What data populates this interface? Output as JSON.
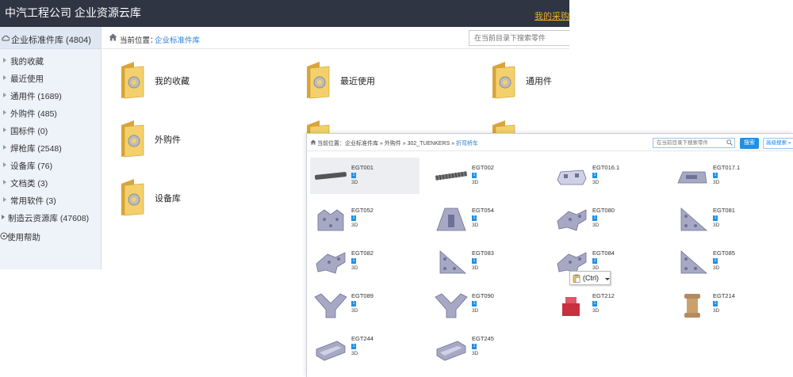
{
  "window": {
    "title": "中汽工程公司 企业资源云库",
    "user_link": "我的采购"
  },
  "sidebar": {
    "top_item": "企业标准件库 (4804)",
    "sub_items": [
      {
        "label": "我的收藏"
      },
      {
        "label": "最近使用"
      },
      {
        "label": "通用件 (1689)"
      },
      {
        "label": "外购件 (485)"
      },
      {
        "label": "国标件 (0)"
      },
      {
        "label": "焊枪库 (2548)"
      },
      {
        "label": "设备库 (76)"
      },
      {
        "label": "文档类 (3)"
      },
      {
        "label": "常用软件 (3)"
      }
    ],
    "root_item": "制造云资源库 (47608)",
    "help_item": "使用帮助"
  },
  "breadcrumb": {
    "label": "当前位置：",
    "link": "企业标准件库"
  },
  "search": {
    "placeholder": "在当前目录下搜索零件"
  },
  "folders": [
    {
      "label": "我的收藏"
    },
    {
      "label": "最近使用"
    },
    {
      "label": "通用件"
    },
    {
      "label": "外购件"
    },
    {
      "label": ""
    },
    {
      "label": ""
    },
    {
      "label": "设备库"
    }
  ],
  "overlay": {
    "breadcrumb": {
      "label": "当前位置：",
      "path": "企业标准件库 » 外购件 » 302_TUENKERS »",
      "current": "折弯桥车"
    },
    "search_placeholder": "在当前目录下搜索零件",
    "search_button": "搜索",
    "advanced_button": "高级搜索 »",
    "accent_color": "#1e90e6",
    "parts": [
      {
        "code": "EGT001",
        "badge": "1",
        "type": "3D",
        "icon": "rod-icon"
      },
      {
        "code": "EGT002",
        "badge": "1",
        "type": "3D",
        "icon": "threaded-rod-icon"
      },
      {
        "code": "EGT016.1",
        "badge": "1",
        "type": "3D",
        "icon": "bracket-icon"
      },
      {
        "code": "EGT017.1",
        "badge": "1",
        "type": "3D",
        "icon": "block-icon"
      },
      {
        "code": "EGT052",
        "badge": "1",
        "type": "3D",
        "icon": "tower-bracket-icon"
      },
      {
        "code": "EGT054",
        "badge": "1",
        "type": "3D",
        "icon": "gusset-bracket-icon"
      },
      {
        "code": "EGT080",
        "badge": "1",
        "type": "3D",
        "icon": "angle-bracket-icon"
      },
      {
        "code": "EGT081",
        "badge": "1",
        "type": "3D",
        "icon": "triangle-plate-icon"
      },
      {
        "code": "EGT082",
        "badge": "1",
        "type": "3D",
        "icon": "angle-bracket-icon"
      },
      {
        "code": "EGT083",
        "badge": "1",
        "type": "3D",
        "icon": "triangle-plate-icon"
      },
      {
        "code": "EGT084",
        "badge": "1",
        "type": "3D",
        "icon": "angle-bracket-icon"
      },
      {
        "code": "EGT085",
        "badge": "1",
        "type": "3D",
        "icon": "triangle-plate-icon"
      },
      {
        "code": "EGT089",
        "badge": "1",
        "type": "3D",
        "icon": "y-bracket-icon"
      },
      {
        "code": "EGT090",
        "badge": "1",
        "type": "3D",
        "icon": "y-bracket-icon"
      },
      {
        "code": "EGT212",
        "badge": "1",
        "type": "3D",
        "icon": "red-block-icon"
      },
      {
        "code": "EGT214",
        "badge": "1",
        "type": "3D",
        "icon": "spool-icon"
      },
      {
        "code": "EGT244",
        "badge": "1",
        "type": "3D",
        "icon": "channel-icon"
      },
      {
        "code": "EGT245",
        "badge": "1",
        "type": "3D",
        "icon": "channel-icon"
      }
    ]
  },
  "paste_popup": {
    "label": "(Ctrl)"
  }
}
